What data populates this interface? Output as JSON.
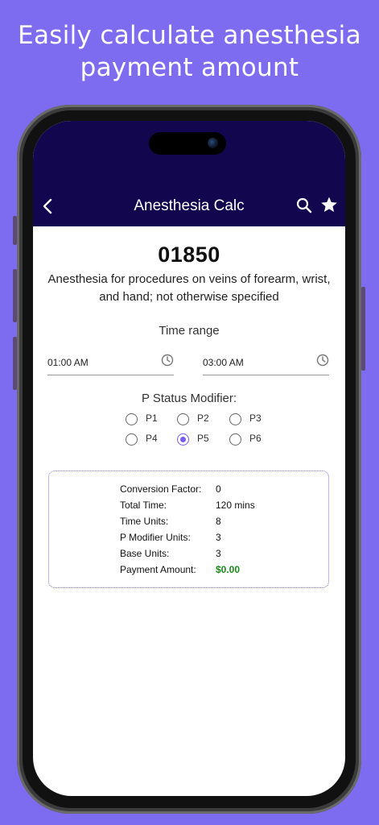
{
  "promo": {
    "line1": "Easily calculate anesthesia",
    "line2": "payment amount"
  },
  "appbar": {
    "title": "Anesthesia Calc",
    "icons": [
      "back-arrow-icon",
      "search-icon",
      "star-icon"
    ]
  },
  "procedure": {
    "code": "01850",
    "description": "Anesthesia for procedures on veins of forearm, wrist, and hand; not otherwise specified"
  },
  "time_range": {
    "label": "Time range",
    "start": "01:00 AM",
    "end": "03:00 AM"
  },
  "p_status": {
    "label": "P Status Modifier:",
    "options": [
      "P1",
      "P2",
      "P3",
      "P4",
      "P5",
      "P6"
    ],
    "selected": "P5"
  },
  "summary": {
    "rows": [
      {
        "label": "Conversion Factor:",
        "value": "0"
      },
      {
        "label": "Total Time:",
        "value": "120 mins"
      },
      {
        "label": "Time Units:",
        "value": "8"
      },
      {
        "label": "P Modifier Units:",
        "value": "3"
      },
      {
        "label": "Base Units:",
        "value": "3"
      },
      {
        "label": "Payment Amount:",
        "value": "$0.00"
      }
    ]
  },
  "colors": {
    "background": "#7e6cf0",
    "appbar": "#12074f",
    "accent": "#7b5cf0",
    "payment": "#1a8a1a"
  }
}
